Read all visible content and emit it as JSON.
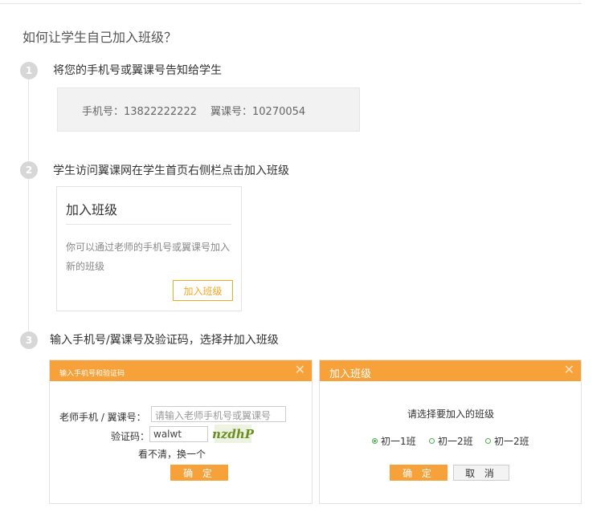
{
  "page": {
    "title": "如何让学生自己加入班级？"
  },
  "steps": [
    {
      "number": "1",
      "title": "将您的手机号或翼课号告知给学生"
    },
    {
      "number": "2",
      "title": "学生访问翼课网在学生首页右侧栏点击加入班级"
    },
    {
      "number": "3",
      "title": "输入手机号/翼课号及验证码，选择并加入班级"
    }
  ],
  "info": {
    "phone": "手机号：13822222222",
    "id": "翼课号：10270054"
  },
  "join_card": {
    "title": "加入班级",
    "desc": "你可以通过老师的手机号或翼课号加入新的班级",
    "button": "加入班级"
  },
  "dialog1": {
    "title": "输入手机号和验证码",
    "phone_label": "老师手机 / 翼课号：",
    "phone_placeholder": "请输入老师手机号或翼课号",
    "captcha_label": "验证码：",
    "captcha_value": "walwt",
    "captcha_image_text": "nzdhP",
    "refresh_link": "看不清，换一个",
    "confirm": "确 定"
  },
  "dialog2": {
    "title": "加入班级",
    "prompt": "请选择要加入的班级",
    "options": [
      {
        "label": "初一1班",
        "selected": true
      },
      {
        "label": "初一2班",
        "selected": false
      },
      {
        "label": "初一2班",
        "selected": false
      }
    ],
    "confirm": "确 定",
    "cancel": "取 消"
  },
  "colors": {
    "accent": "#f6a13a",
    "radio": "#4caf50"
  }
}
